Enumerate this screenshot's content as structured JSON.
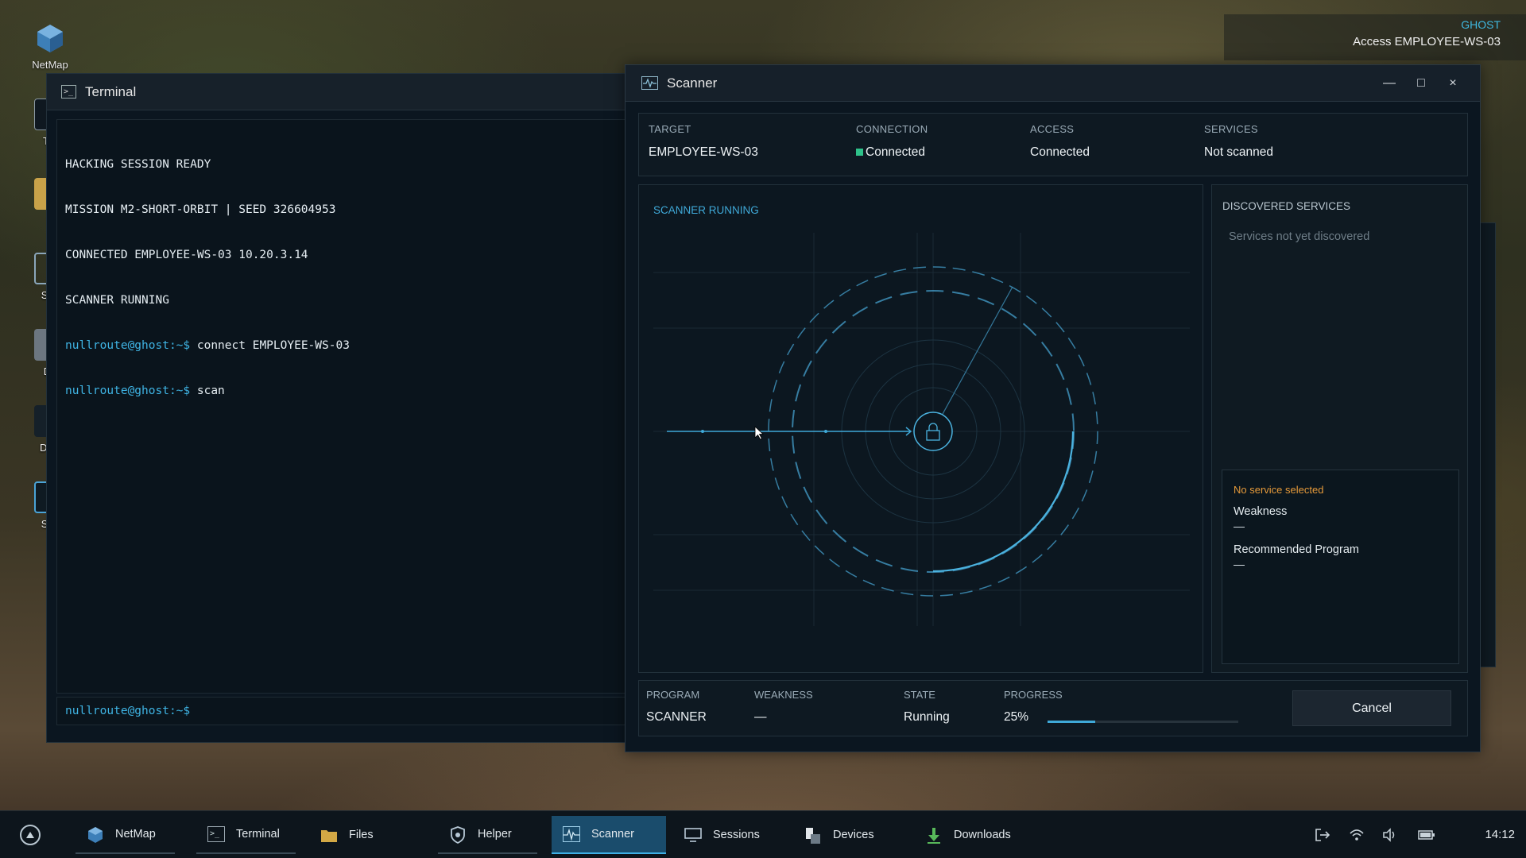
{
  "desktop": {
    "icons": [
      {
        "label": "NetMap"
      },
      {
        "label": "Ter"
      },
      {
        "label": "F"
      },
      {
        "label": "Ses"
      },
      {
        "label": "De"
      },
      {
        "label": "Dow"
      },
      {
        "label": "Sca"
      }
    ]
  },
  "tray_info": {
    "user": "GHOST",
    "status": "Access EMPLOYEE-WS-03"
  },
  "terminal": {
    "title": "Terminal",
    "lines": [
      {
        "text": "HACKING SESSION READY"
      },
      {
        "text": "MISSION M2-SHORT-ORBIT | SEED 326604953"
      },
      {
        "text": "CONNECTED EMPLOYEE-WS-03 10.20.3.14"
      },
      {
        "text": "SCANNER RUNNING"
      },
      {
        "prompt": "nullroute@ghost:~$",
        "cmd": " connect EMPLOYEE-WS-03"
      },
      {
        "prompt": "nullroute@ghost:~$",
        "cmd": " scan"
      }
    ],
    "input_prompt": "nullroute@ghost:~$"
  },
  "scanner": {
    "title": "Scanner",
    "controls": {
      "minimize": "—",
      "maximize": "□",
      "close": "×"
    },
    "target": {
      "label": "TARGET",
      "value": "EMPLOYEE-WS-03"
    },
    "connection": {
      "label": "CONNECTION",
      "value": "Connected",
      "color": "#2ec28a"
    },
    "access": {
      "label": "ACCESS",
      "value": "Connected"
    },
    "services": {
      "label": "SERVICES",
      "value": "Not scanned"
    },
    "radar_status": "SCANNER RUNNING",
    "discovered": {
      "heading": "DISCOVERED SERVICES",
      "empty_text": "Services not yet discovered"
    },
    "service_detail": {
      "none_selected": "No service selected",
      "weakness_label": "Weakness",
      "recommended_label": "Recommended Program"
    },
    "program": {
      "label": "PROGRAM",
      "value": "SCANNER"
    },
    "weakness": {
      "label": "WEAKNESS",
      "value": "—"
    },
    "state": {
      "label": "STATE",
      "value": "Running"
    },
    "progress": {
      "label": "PROGRESS",
      "text": "25%",
      "fraction": 0.25
    },
    "cancel_label": "Cancel",
    "accent_color": "#3fa9d8"
  },
  "taskbar": {
    "items": [
      {
        "label": "NetMap",
        "icon": "netmap-icon"
      },
      {
        "label": "Terminal",
        "icon": "terminal-icon"
      },
      {
        "label": "Files",
        "icon": "folder-icon"
      },
      {
        "label": "Helper",
        "icon": "shield-icon"
      },
      {
        "label": "Scanner",
        "icon": "scanner-icon"
      },
      {
        "label": "Sessions",
        "icon": "monitor-icon"
      },
      {
        "label": "Devices",
        "icon": "devices-icon"
      },
      {
        "label": "Downloads",
        "icon": "download-icon"
      }
    ],
    "clock": "14:12"
  }
}
